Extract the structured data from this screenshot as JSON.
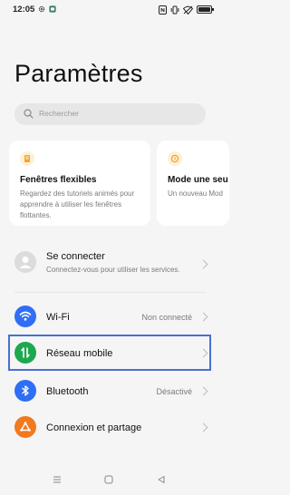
{
  "status_bar": {
    "time": "12:05",
    "icons": [
      "settings-gear-icon",
      "app-notification-icon",
      "nfc-icon",
      "vibrate-icon",
      "wifi-off-icon",
      "battery-icon"
    ],
    "battery_level": 0.85
  },
  "page": {
    "title": "Paramètres"
  },
  "search": {
    "placeholder": "Rechercher"
  },
  "cards": [
    {
      "icon": "flexible-windows-icon",
      "title": "Fenêtres flexibles",
      "description": "Regardez des tutoriels animés pour apprendre à utiliser les fenêtres flottantes."
    },
    {
      "icon": "silent-mode-icon",
      "title": "Mode une seu",
      "description": "Un nouveau Mod"
    }
  ],
  "account": {
    "label": "Se connecter",
    "sub": "Connectez-vous pour utiliser les services."
  },
  "settings": [
    {
      "label": "Wi-Fi",
      "value": "Non connecté",
      "icon": "wifi-icon",
      "color": "#2f6ef5"
    },
    {
      "label": "Réseau mobile",
      "value": "",
      "icon": "mobile-data-icon",
      "color": "#1ea84e"
    },
    {
      "label": "Bluetooth",
      "value": "Désactivé",
      "icon": "bluetooth-icon",
      "color": "#2f6ef5"
    },
    {
      "label": "Connexion et partage",
      "value": "",
      "icon": "share-connection-icon",
      "color": "#f07a1e"
    }
  ],
  "colors": {
    "background": "#f5f5f5",
    "card": "#ffffff",
    "highlight_border": "#4a6fd3"
  },
  "nav": {
    "buttons": [
      "menu-icon",
      "home-icon",
      "back-icon"
    ]
  }
}
